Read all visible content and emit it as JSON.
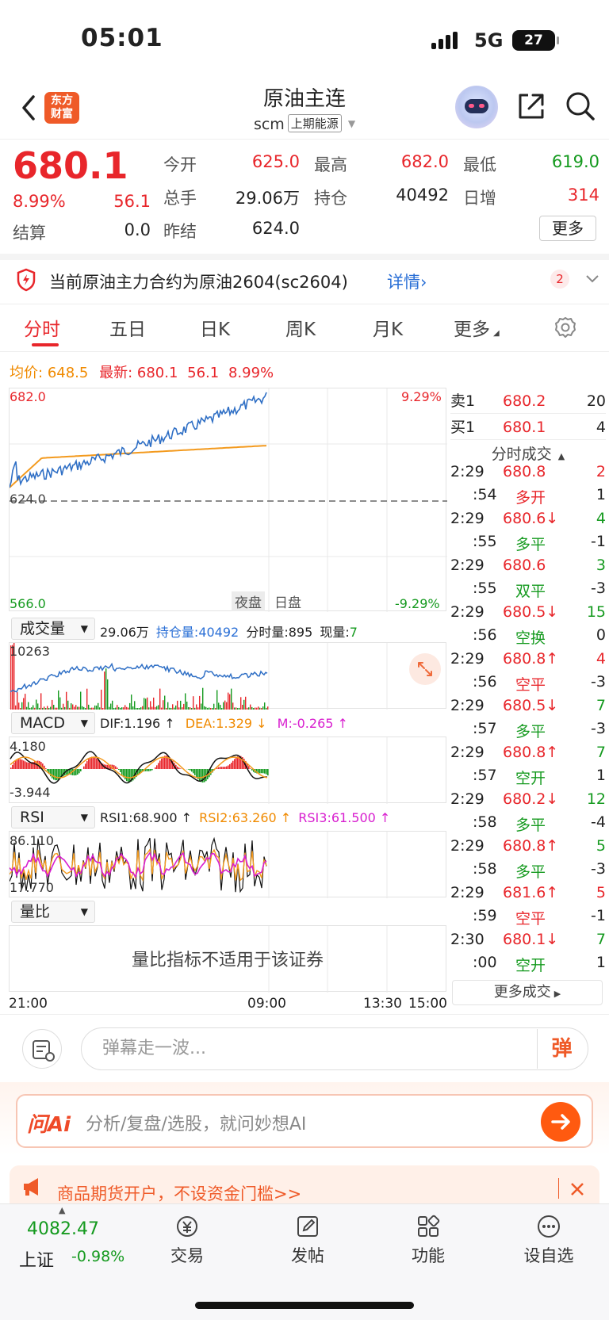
{
  "status": {
    "time": "05:01",
    "network": "5G",
    "battery": "27"
  },
  "header": {
    "logo_line1": "东方",
    "logo_line2": "财富",
    "title": "原油主连",
    "code": "scm",
    "exchange": "上期能源"
  },
  "quote": {
    "price": "680.1",
    "pct": "8.99%",
    "change": "56.1",
    "open_label": "今开",
    "open": "625.0",
    "high_label": "最高",
    "high": "682.0",
    "low_label": "最低",
    "low": "619.0",
    "volume_label": "总手",
    "volume": "29.06万",
    "oi_label": "持仓",
    "oi": "40492",
    "daily_inc_label": "日增",
    "daily_inc": "314",
    "settle_label": "结算",
    "settle": "0.0",
    "prev_settle_label": "昨结",
    "prev_settle": "624.0",
    "more_label": "更多"
  },
  "notice": {
    "text": "当前原油主力合约为原油2604(sc2604)",
    "link": "详情",
    "badge": "2"
  },
  "tabs": [
    "分时",
    "五日",
    "日K",
    "周K",
    "月K",
    "更多"
  ],
  "summary": {
    "avg_label": "均价:",
    "avg": "648.5",
    "latest_label": "最新:",
    "latest": "680.1",
    "chg": "56.1",
    "pct": "8.99%"
  },
  "chart_labels": {
    "y_high": "682.0",
    "y_mid": "624.0",
    "y_low": "566.0",
    "pct_high": "9.29%",
    "pct_low": "-9.29%",
    "night": "夜盘",
    "day": "日盘",
    "x_ticks": [
      "21:00",
      "09:00",
      "13:30",
      "15:00"
    ]
  },
  "volume_ind": {
    "selector": "成交量",
    "vol": "29.06万",
    "oi_label": "持仓量:",
    "oi": "40492",
    "tv_label": "分时量:",
    "tv": "895",
    "cur_label": "现量:",
    "cur": "7",
    "max": "10263"
  },
  "macd_ind": {
    "selector": "MACD",
    "dif": "DIF:1.196 ↑",
    "dea": "DEA:1.329 ↓",
    "m": "M:-0.265 ↑",
    "top": "4.180",
    "bottom": "-3.944"
  },
  "rsi_ind": {
    "selector": "RSI",
    "rsi1": "RSI1:68.900 ↑",
    "rsi2": "RSI2:63.260 ↑",
    "rsi3": "RSI3:61.500 ↑",
    "top": "86.110",
    "bottom": "17.770"
  },
  "ratio_ind": {
    "selector": "量比",
    "msg": "量比指标不适用于该证券"
  },
  "orderbook": {
    "ask_label": "卖1",
    "ask": "680.2",
    "ask_vol": "20",
    "bid_label": "买1",
    "bid": "680.1",
    "bid_vol": "4"
  },
  "ticks": {
    "header": "分时成交",
    "rows": [
      {
        "t1": "2:29",
        "t2": ":54",
        "price": "680.8",
        "vol": "2",
        "type": "多开",
        "oi": "1",
        "pc": "red",
        "vc": "red",
        "tc": "red"
      },
      {
        "t1": "2:29",
        "t2": ":55",
        "price": "680.6↓",
        "vol": "4",
        "type": "多平",
        "oi": "-1",
        "pc": "red",
        "vc": "green",
        "tc": "green"
      },
      {
        "t1": "2:29",
        "t2": ":55",
        "price": "680.6",
        "vol": "3",
        "type": "双平",
        "oi": "-3",
        "pc": "red",
        "vc": "green",
        "tc": "green"
      },
      {
        "t1": "2:29",
        "t2": ":56",
        "price": "680.5↓",
        "vol": "15",
        "type": "空换",
        "oi": "0",
        "pc": "red",
        "vc": "green",
        "tc": "green"
      },
      {
        "t1": "2:29",
        "t2": ":56",
        "price": "680.8↑",
        "vol": "4",
        "type": "空平",
        "oi": "-3",
        "pc": "red",
        "vc": "red",
        "tc": "red"
      },
      {
        "t1": "2:29",
        "t2": ":57",
        "price": "680.5↓",
        "vol": "7",
        "type": "多平",
        "oi": "-3",
        "pc": "red",
        "vc": "green",
        "tc": "green"
      },
      {
        "t1": "2:29",
        "t2": ":57",
        "price": "680.8↑",
        "vol": "7",
        "type": "空开",
        "oi": "1",
        "pc": "red",
        "vc": "green",
        "tc": "green"
      },
      {
        "t1": "2:29",
        "t2": ":58",
        "price": "680.2↓",
        "vol": "12",
        "type": "多平",
        "oi": "-4",
        "pc": "red",
        "vc": "green",
        "tc": "green"
      },
      {
        "t1": "2:29",
        "t2": ":58",
        "price": "680.8↑",
        "vol": "5",
        "type": "多平",
        "oi": "-3",
        "pc": "red",
        "vc": "green",
        "tc": "green"
      },
      {
        "t1": "2:29",
        "t2": ":59",
        "price": "681.6↑",
        "vol": "5",
        "type": "空平",
        "oi": "-1",
        "pc": "red",
        "vc": "red",
        "tc": "red"
      },
      {
        "t1": "2:30",
        "t2": ":00",
        "price": "680.1↓",
        "vol": "7",
        "type": "空开",
        "oi": "1",
        "pc": "red",
        "vc": "green",
        "tc": "green"
      }
    ],
    "more": "更多成交"
  },
  "comment": {
    "placeholder": "弹幕走一波...",
    "dm": "弹"
  },
  "ai": {
    "brand": "问Ai",
    "placeholder": "分析/复盘/选股，就问妙想AI"
  },
  "ad": {
    "text": "商品期货开户，不设资金门槛>>"
  },
  "bottom_nav": {
    "index_value": "4082.47",
    "index_name": "上证",
    "index_pct": "-0.98%",
    "items": [
      "交易",
      "发帖",
      "功能",
      "设自选"
    ]
  },
  "colors": {
    "up": "#e8262b",
    "down": "#159a1f",
    "accent": "#ef5a28",
    "price_line": "#2f6fc5",
    "avg_line": "#f39a1e"
  }
}
